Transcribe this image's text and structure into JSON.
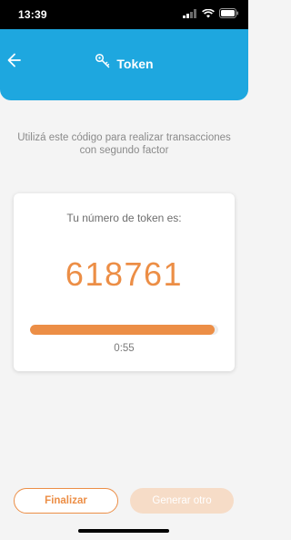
{
  "status_bar": {
    "time": "13:39",
    "icons": [
      "cellular-signal-icon",
      "wifi-icon",
      "battery-icon"
    ]
  },
  "header": {
    "title": "Token",
    "icon": "key-icon",
    "back_icon": "back-arrow-icon",
    "color": "#1ea7df"
  },
  "instructions": "Utilizá este código para realizar transacciones con segundo factor",
  "token": {
    "label": "Tu número de token es:",
    "value": "618761",
    "timer": "0:55",
    "progress": 0.98,
    "accent_color": "#ec8e46"
  },
  "buttons": {
    "finalize_label": "Finalizar",
    "generate_label": "Generar otro"
  }
}
